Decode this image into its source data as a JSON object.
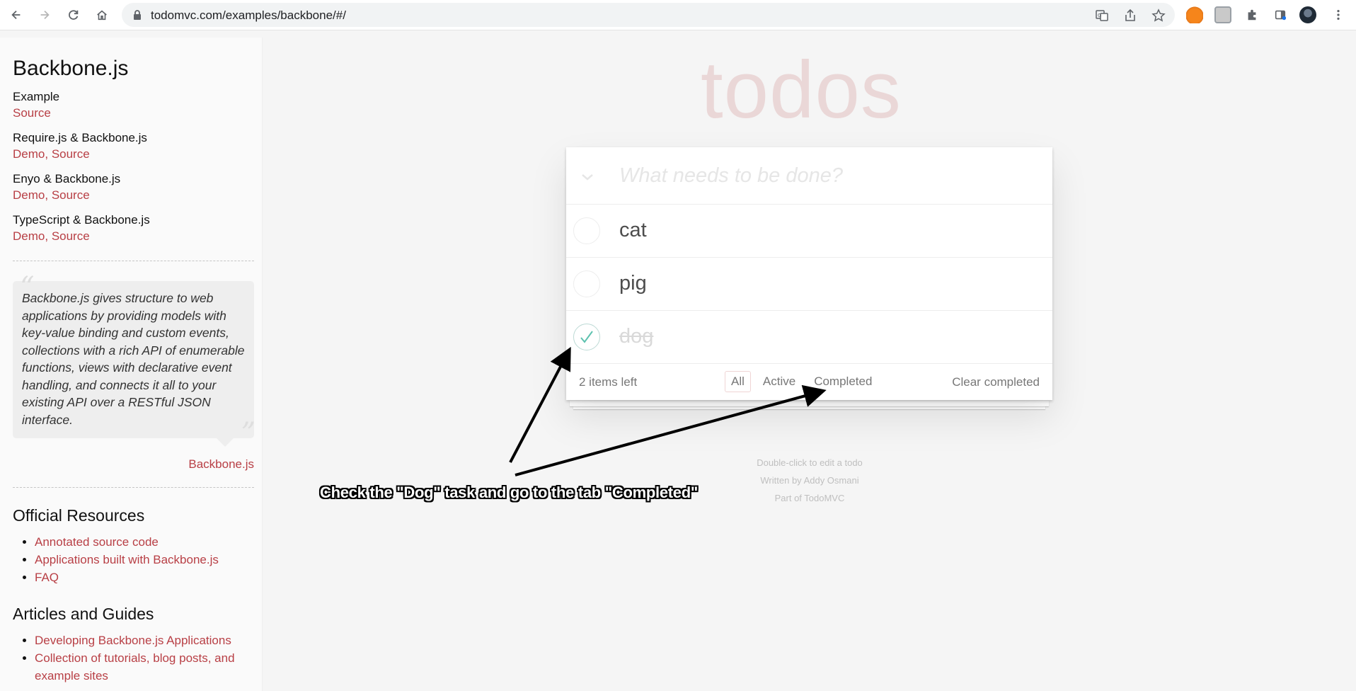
{
  "browser": {
    "url": "todomvc.com/examples/backbone/#/"
  },
  "sidebar": {
    "title": "Backbone.js",
    "groups": [
      {
        "label": "Example",
        "links": [
          "Source"
        ]
      },
      {
        "label": "Require.js & Backbone.js",
        "links": [
          "Demo",
          "Source"
        ]
      },
      {
        "label": "Enyo & Backbone.js",
        "links": [
          "Demo",
          "Source"
        ]
      },
      {
        "label": "TypeScript & Backbone.js",
        "links": [
          "Demo",
          "Source"
        ]
      }
    ],
    "quote": "Backbone.js gives structure to web applications by providing models with key-value binding and custom events, collections with a rich API of enumerable functions, views with declarative event handling, and connects it all to your existing API over a RESTful JSON interface.",
    "quote_author": "Backbone.js",
    "official_resources": {
      "heading": "Official Resources",
      "items": [
        "Annotated source code",
        "Applications built with Backbone.js",
        "FAQ"
      ]
    },
    "articles": {
      "heading": "Articles and Guides",
      "items": [
        "Developing Backbone.js Applications",
        "Collection of tutorials, blog posts, and example sites"
      ]
    }
  },
  "app": {
    "title": "todos",
    "placeholder": "What needs to be done?",
    "todos": [
      {
        "label": "cat",
        "completed": false
      },
      {
        "label": "pig",
        "completed": false
      },
      {
        "label": "dog",
        "completed": true
      }
    ],
    "footer": {
      "count": "2 items left",
      "filters": [
        "All",
        "Active",
        "Completed"
      ],
      "selected_filter": "All",
      "clear": "Clear completed"
    },
    "info": [
      "Double-click to edit a todo",
      "Written by Addy Osmani",
      "Part of TodoMVC"
    ]
  },
  "annotation": {
    "text": "Check the \"Dog\" task and go to the tab \"Completed\""
  },
  "colors": {
    "link": "#b83f45",
    "check_done": "#5dc2af",
    "title": "rgba(175,47,47,0.15)"
  },
  "icons": [
    "back-icon",
    "forward-icon",
    "reload-icon",
    "home-icon",
    "lock-icon",
    "translate-icon",
    "share-icon",
    "bookmark-star-icon",
    "metamask-fox-icon",
    "extension-icon",
    "puzzle-icon",
    "side-panel-icon",
    "profile-avatar",
    "menu-dots-icon"
  ]
}
